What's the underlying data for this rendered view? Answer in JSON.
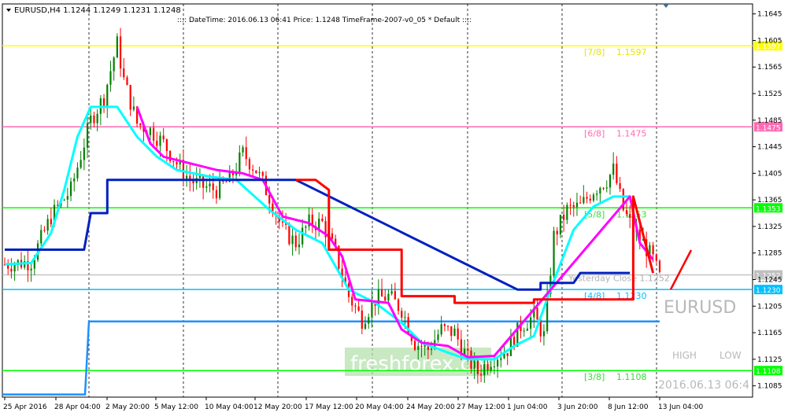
{
  "header": {
    "symbol_line": "EURUSD,H4  1.1244 1.1249 1.1231 1.1248",
    "info_line": ":::: DateTime: 2016.06.13 06:41    Price: 1.1248    TimeFrame-2007-v0_05    *   Default   ::::"
  },
  "watermarks": {
    "symbol": "EURUSD",
    "brand": "freshforex.com",
    "high_label": "HIGH",
    "low_label": "LOW",
    "datetime": "2016.06.13 06:4"
  },
  "colors": {
    "bull": "#008000",
    "bear": "#ff0000",
    "bg": "#ffffff",
    "yellow": "#ffff00",
    "pink": "#ff69b4",
    "green": "#00ff00",
    "skyblue": "#00bfff",
    "dodger": "#1e90ff",
    "magenta": "#ff00ff",
    "cyan": "#00ffff",
    "navy": "#0020c0",
    "red": "#ff0000"
  },
  "levels": [
    {
      "label": "[7/8]",
      "value": "1.1597",
      "price": 1.1597,
      "axis": "1.1597",
      "color": "#ffff00",
      "text_color": "#e6e600"
    },
    {
      "label": "[6/8]",
      "value": "1.1475",
      "price": 1.1475,
      "axis": "1.1475",
      "color": "#ff69b4",
      "text_color": "#ff69b4"
    },
    {
      "label": "[5/8]",
      "value": "1.1353",
      "price": 1.1353,
      "axis": "1.1353",
      "color": "#00ff00",
      "text_color": "#33dd33"
    },
    {
      "label": "[4/8]",
      "value": "1.1230",
      "price": 1.123,
      "axis": "1.1230",
      "color": "#00bfff",
      "text_color": "#00bfff"
    },
    {
      "label": "[3/8]",
      "value": "1.1108",
      "price": 1.1108,
      "axis": "1.1108",
      "color": "#00ff00",
      "text_color": "#33dd33"
    }
  ],
  "yesterday": {
    "label": "Yesterday Close 1.1252",
    "price": 1.1252,
    "axis": "1.1252"
  },
  "price_axis": [
    "1.1645",
    "1.1605",
    "1.1565",
    "1.1525",
    "1.1485",
    "1.1445",
    "1.1405",
    "1.1365",
    "1.1325",
    "1.1285",
    "1.1245",
    "1.1205",
    "1.1165",
    "1.1125",
    "1.1085"
  ],
  "time_axis": [
    "25 Apr 2016",
    "28 Apr 04:00",
    "2 May 20:00",
    "5 May 12:00",
    "10 May 04:00",
    "12 May 20:00",
    "17 May 12:00",
    "20 May 04:00",
    "24 May 20:00",
    "27 May 12:00",
    "1 Jun 04:00",
    "3 Jun 20:00",
    "8 Jun 12:00",
    "13 Jun 04:00"
  ],
  "chart_data": {
    "type": "candlestick",
    "symbol": "EURUSD",
    "timeframe": "H4",
    "ylim": [
      1.1068,
      1.166
    ],
    "grid": "vertical-dashed",
    "anchors": [
      [
        0,
        1.1268
      ],
      [
        8,
        1.1272
      ],
      [
        14,
        1.134
      ],
      [
        20,
        1.138
      ],
      [
        26,
        1.1485
      ],
      [
        30,
        1.152
      ],
      [
        34,
        1.16
      ],
      [
        36,
        1.1545
      ],
      [
        40,
        1.148
      ],
      [
        44,
        1.147
      ],
      [
        48,
        1.145
      ],
      [
        52,
        1.142
      ],
      [
        56,
        1.1395
      ],
      [
        60,
        1.1385
      ],
      [
        64,
        1.138
      ],
      [
        68,
        1.1395
      ],
      [
        72,
        1.1435
      ],
      [
        76,
        1.141
      ],
      [
        80,
        1.137
      ],
      [
        84,
        1.132
      ],
      [
        88,
        1.13
      ],
      [
        92,
        1.133
      ],
      [
        96,
        1.133
      ],
      [
        100,
        1.1285
      ],
      [
        104,
        1.122
      ],
      [
        108,
        1.1185
      ],
      [
        112,
        1.1215
      ],
      [
        116,
        1.122
      ],
      [
        120,
        1.12
      ],
      [
        124,
        1.115
      ],
      [
        128,
        1.114
      ],
      [
        132,
        1.117
      ],
      [
        136,
        1.1165
      ],
      [
        140,
        1.1125
      ],
      [
        143,
        1.1105
      ],
      [
        147,
        1.1125
      ],
      [
        152,
        1.114
      ],
      [
        156,
        1.1175
      ],
      [
        160,
        1.119
      ],
      [
        163,
        1.116
      ],
      [
        166,
        1.131
      ],
      [
        170,
        1.135
      ],
      [
        174,
        1.1355
      ],
      [
        178,
        1.138
      ],
      [
        182,
        1.1395
      ],
      [
        184,
        1.141
      ],
      [
        187,
        1.135
      ],
      [
        190,
        1.132
      ],
      [
        193,
        1.13
      ],
      [
        196,
        1.1275
      ],
      [
        198,
        1.1248
      ]
    ],
    "indicators": {
      "cyan": [
        [
          0,
          1.1268
        ],
        [
          8,
          1.127
        ],
        [
          14,
          1.1315
        ],
        [
          18,
          1.138
        ],
        [
          22,
          1.146
        ],
        [
          26,
          1.1505
        ],
        [
          34,
          1.1505
        ],
        [
          34,
          1.1505
        ],
        [
          40,
          1.146
        ],
        [
          46,
          1.143
        ],
        [
          52,
          1.141
        ],
        [
          62,
          1.14
        ],
        [
          70,
          1.1395
        ],
        [
          80,
          1.135
        ],
        [
          88,
          1.132
        ],
        [
          96,
          1.13
        ],
        [
          104,
          1.123
        ],
        [
          112,
          1.121
        ],
        [
          120,
          1.118
        ],
        [
          126,
          1.115
        ],
        [
          134,
          1.1135
        ],
        [
          140,
          1.1125
        ],
        [
          148,
          1.1125
        ],
        [
          154,
          1.1145
        ],
        [
          160,
          1.116
        ],
        [
          165,
          1.123
        ],
        [
          172,
          1.132
        ],
        [
          178,
          1.1355
        ],
        [
          184,
          1.137
        ],
        [
          189,
          1.137
        ]
      ],
      "magenta": [
        [
          40,
          1.1505
        ],
        [
          44,
          1.145
        ],
        [
          48,
          1.143
        ],
        [
          56,
          1.142
        ],
        [
          64,
          1.141
        ],
        [
          72,
          1.1405
        ],
        [
          78,
          1.1395
        ],
        [
          84,
          1.134
        ],
        [
          92,
          1.133
        ],
        [
          98,
          1.131
        ],
        [
          102,
          1.128
        ],
        [
          106,
          1.1215
        ],
        [
          116,
          1.121
        ],
        [
          120,
          1.117
        ],
        [
          126,
          1.115
        ],
        [
          134,
          1.1145
        ],
        [
          140,
          1.1128
        ],
        [
          148,
          1.113
        ],
        [
          189,
          1.137
        ],
        [
          192,
          1.13
        ],
        [
          196,
          1.1275
        ]
      ],
      "navy": [
        [
          0,
          1.129
        ],
        [
          24,
          1.129
        ],
        [
          26,
          1.1345
        ],
        [
          31,
          1.1345
        ],
        [
          31,
          1.1395
        ],
        [
          88,
          1.1395
        ],
        [
          155,
          1.123
        ],
        [
          162,
          1.123
        ],
        [
          162,
          1.124
        ],
        [
          172,
          1.124
        ],
        [
          174,
          1.1255
        ],
        [
          189,
          1.1255
        ]
      ],
      "red": [
        [
          88,
          1.1395
        ],
        [
          94,
          1.1395
        ],
        [
          98,
          1.138
        ],
        [
          98,
          1.129
        ],
        [
          120,
          1.129
        ],
        [
          120,
          1.122
        ],
        [
          136,
          1.122
        ],
        [
          136,
          1.121
        ],
        [
          160,
          1.121
        ],
        [
          160,
          1.1215
        ],
        [
          190,
          1.1215
        ],
        [
          190,
          1.137
        ],
        [
          196,
          1.1255
        ]
      ]
    }
  }
}
